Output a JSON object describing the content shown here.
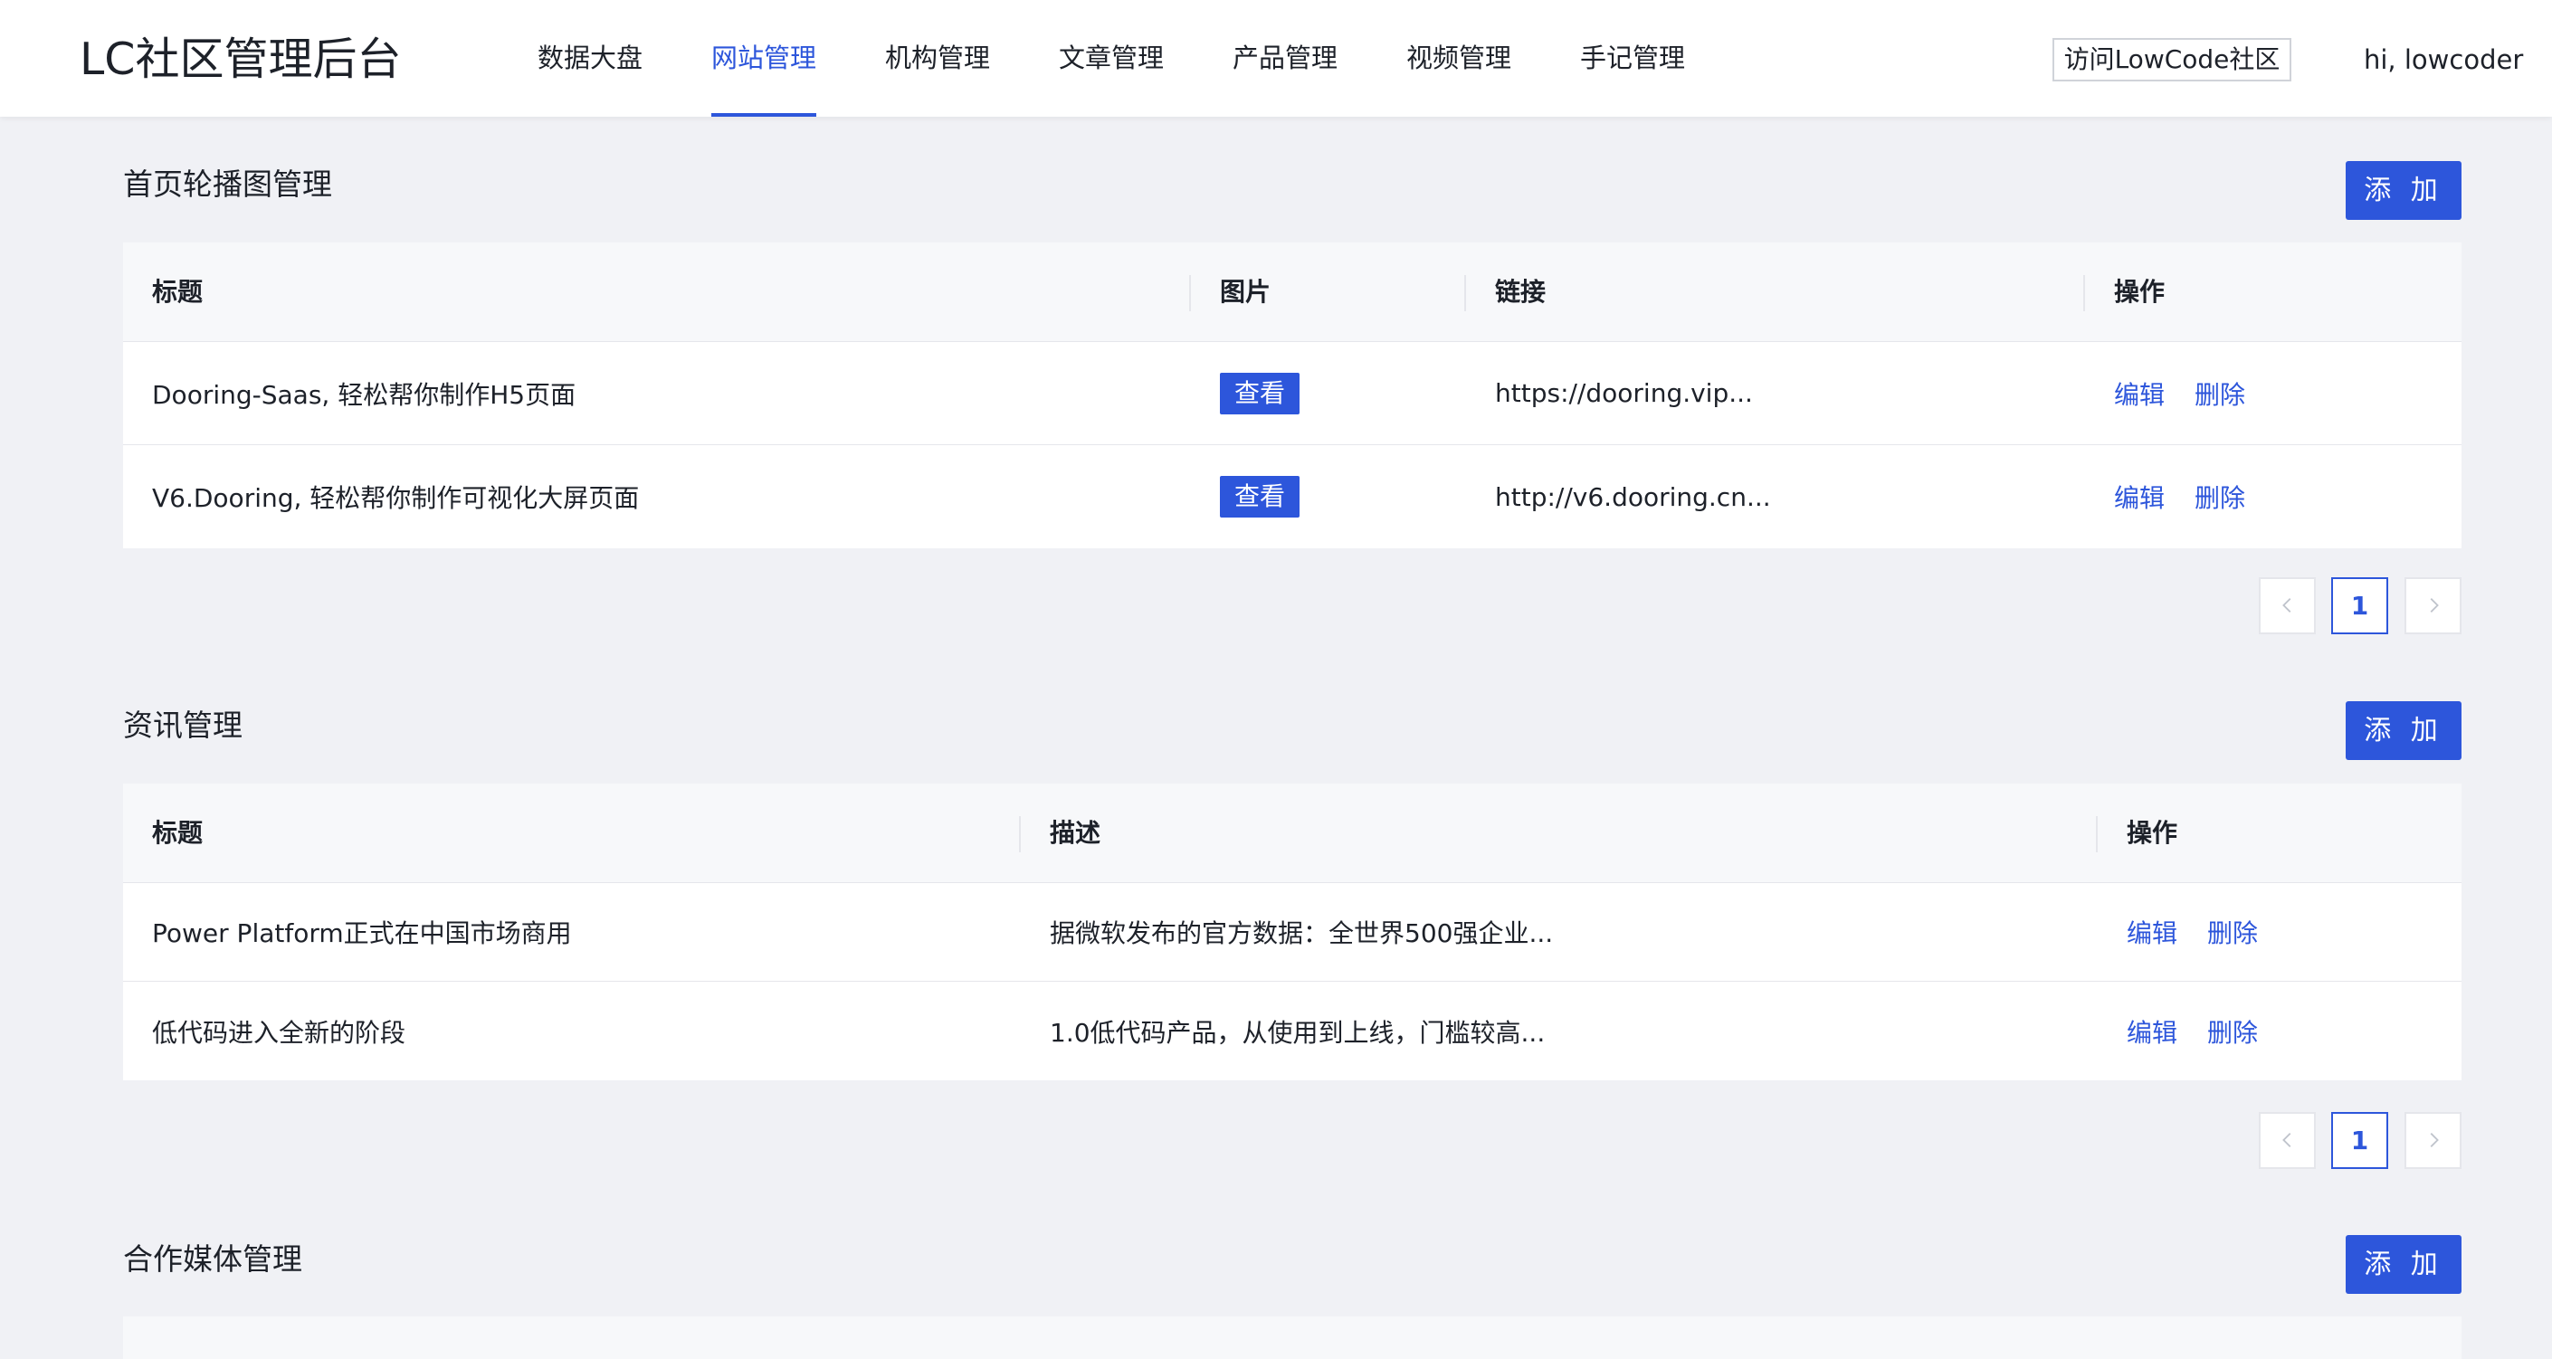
{
  "header": {
    "brand": "LC社区管理后台",
    "nav": [
      {
        "label": "数据大盘",
        "active": false
      },
      {
        "label": "网站管理",
        "active": true
      },
      {
        "label": "机构管理",
        "active": false
      },
      {
        "label": "文章管理",
        "active": false
      },
      {
        "label": "产品管理",
        "active": false
      },
      {
        "label": "视频管理",
        "active": false
      },
      {
        "label": "手记管理",
        "active": false
      }
    ],
    "visit_button": "访问LowCode社区",
    "greeting": "hi, lowcoder"
  },
  "carousel": {
    "title": "首页轮播图管理",
    "add_label": "添 加",
    "columns": [
      "标题",
      "图片",
      "链接",
      "操作"
    ],
    "rows": [
      {
        "title": "Dooring-Saas, 轻松帮你制作H5页面",
        "image": "查看",
        "link": "https://dooring.vip...",
        "edit": "编辑",
        "delete": "删除"
      },
      {
        "title": "V6.Dooring, 轻松帮你制作可视化大屏页面",
        "image": "查看",
        "link": "http://v6.dooring.cn...",
        "edit": "编辑",
        "delete": "删除"
      }
    ],
    "page": "1"
  },
  "news": {
    "title": "资讯管理",
    "add_label": "添 加",
    "columns": [
      "标题",
      "描述",
      "操作"
    ],
    "rows": [
      {
        "title": "Power Platform正式在中国市场商用",
        "desc": "据微软发布的官方数据：全世界500强企业...",
        "edit": "编辑",
        "delete": "删除"
      },
      {
        "title": "低代码进入全新的阶段",
        "desc": "1.0低代码产品，从使用到上线，门槛较高...",
        "edit": "编辑",
        "delete": "删除"
      }
    ],
    "page": "1"
  },
  "media": {
    "title": "合作媒体管理",
    "add_label": "添 加"
  },
  "colors": {
    "primary": "#2d56db",
    "page_bg": "#f0f1f5",
    "header_bg": "#ffffff",
    "table_head_bg": "#f7f8fa"
  }
}
